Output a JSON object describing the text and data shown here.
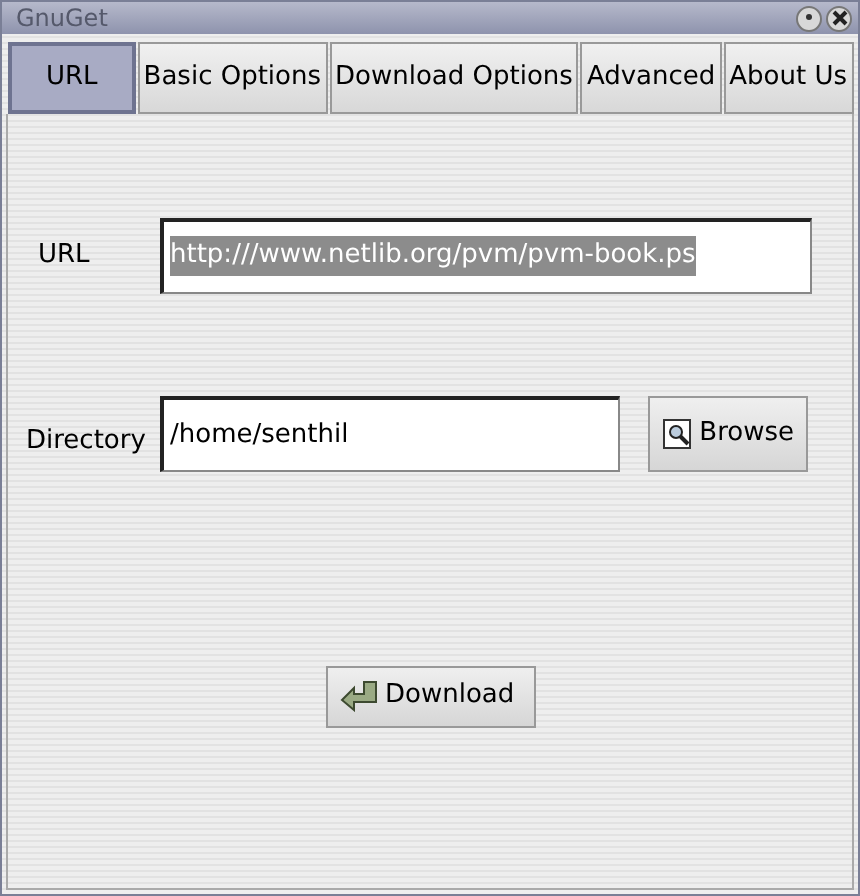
{
  "window": {
    "title": "GnuGet"
  },
  "tabs": [
    {
      "label": "URL",
      "selected": true
    },
    {
      "label": "Basic Options",
      "selected": false
    },
    {
      "label": "Download Options",
      "selected": false
    },
    {
      "label": "Advanced",
      "selected": false
    },
    {
      "label": "About Us",
      "selected": false
    }
  ],
  "url": {
    "label": "URL",
    "value": "http:///www.netlib.org/pvm/pvm-book.ps",
    "selected": true
  },
  "directory": {
    "label": "Directory",
    "value": "/home/senthil",
    "button": "Browse"
  },
  "download_button": "Download"
}
